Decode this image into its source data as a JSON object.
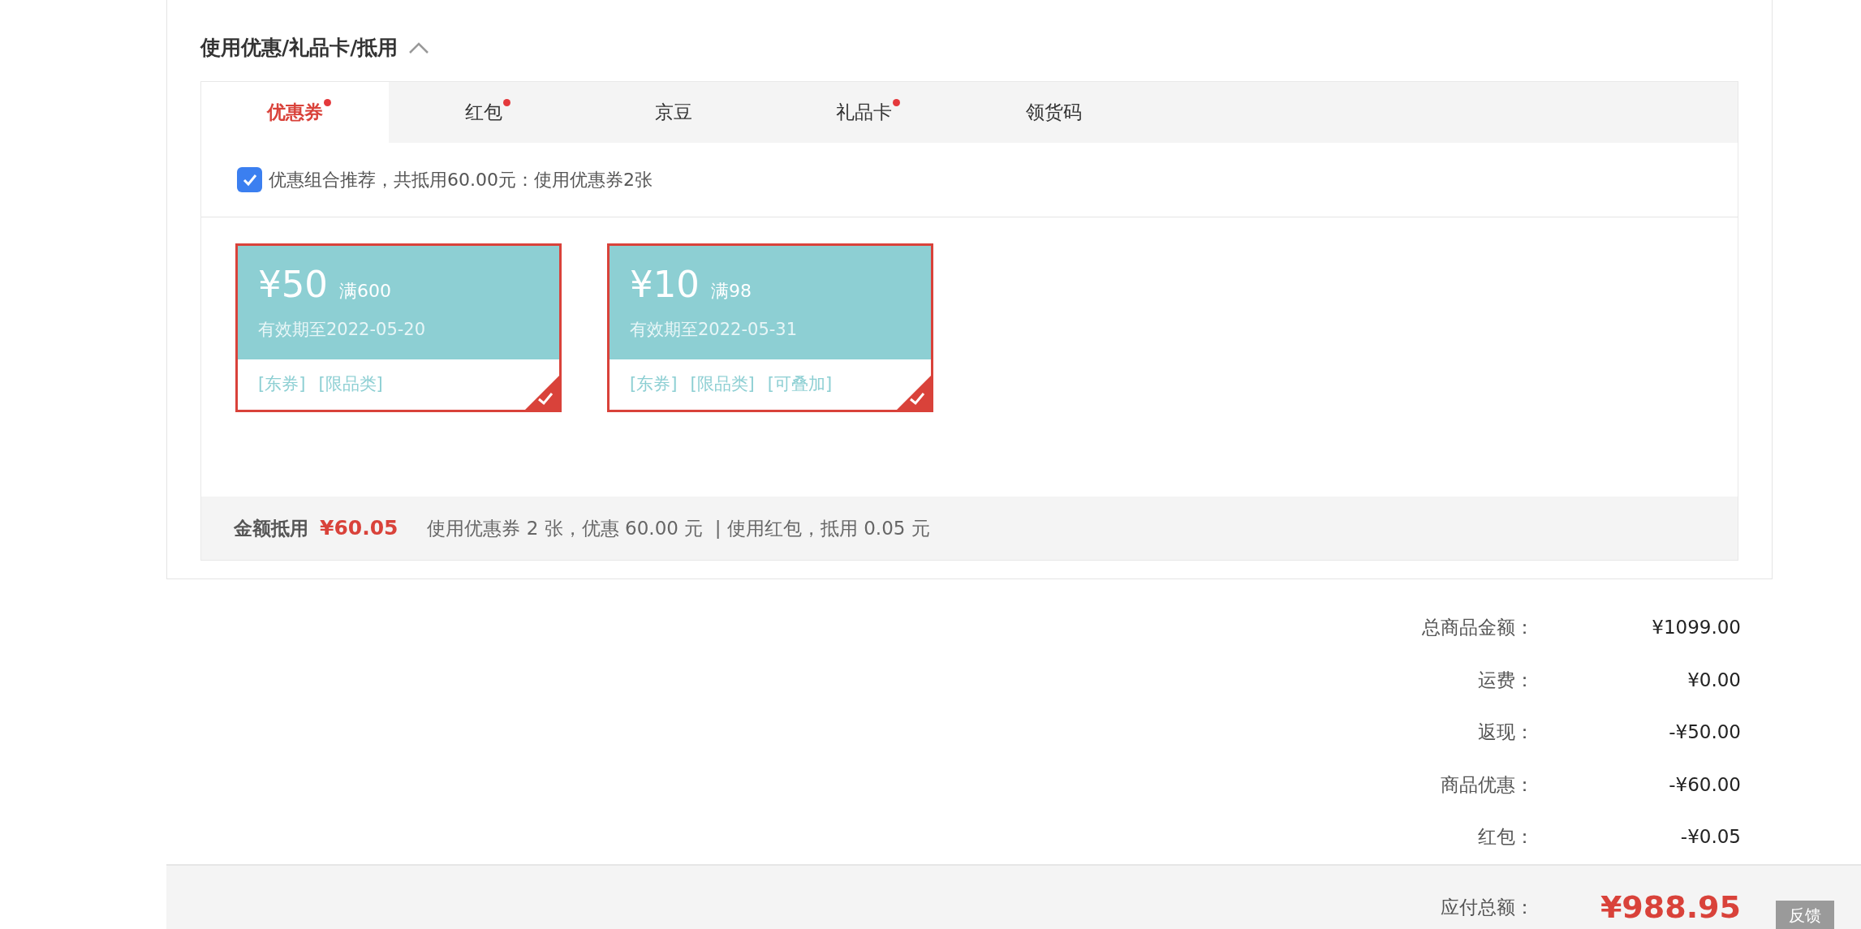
{
  "section": {
    "title": "使用优惠/礼品卡/抵用",
    "expanded": true
  },
  "tabs": [
    {
      "label": "优惠券",
      "selected": true,
      "dot": true
    },
    {
      "label": "红包",
      "selected": false,
      "dot": true
    },
    {
      "label": "京豆",
      "selected": false,
      "dot": false
    },
    {
      "label": "礼品卡",
      "selected": false,
      "dot": true
    },
    {
      "label": "领货码",
      "selected": false,
      "dot": false
    }
  ],
  "recommend": {
    "checked": true,
    "label": "优惠组合推荐，共抵用60.00元：使用优惠券2张"
  },
  "coupons": [
    {
      "amount": "¥50",
      "condition": "满600",
      "validity": "有效期至2022-05-20",
      "tags": [
        "[东券]",
        "[限品类]"
      ],
      "selected": true
    },
    {
      "amount": "¥10",
      "condition": "满98",
      "validity": "有效期至2022-05-31",
      "tags": [
        "[东券]",
        "[限品类]",
        "[可叠加]"
      ],
      "selected": true
    }
  ],
  "deduction": {
    "label": "金额抵用",
    "amount": "¥60.05",
    "detail": "使用优惠券 2 张，优惠 60.00 元  | 使用红包，抵用 0.05 元"
  },
  "summary": [
    {
      "label": "总商品金额：",
      "value": "¥1099.00"
    },
    {
      "label": "运费：",
      "value": "¥0.00"
    },
    {
      "label": "返现：",
      "value": "-¥50.00"
    },
    {
      "label": "商品优惠：",
      "value": "-¥60.00"
    },
    {
      "label": "红包：",
      "value": "-¥0.05"
    }
  ],
  "total": {
    "label": "应付总额：",
    "value": "¥988.95"
  },
  "feedback_button": "反馈"
}
